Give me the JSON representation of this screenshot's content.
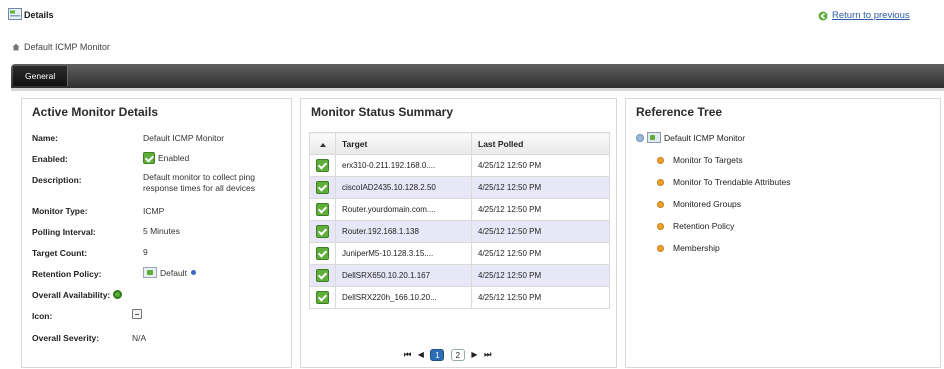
{
  "header": {
    "title": "Details",
    "return_link": "Return to previous"
  },
  "breadcrumb": {
    "text": "Default ICMP Monitor"
  },
  "tabs": [
    {
      "label": "General"
    }
  ],
  "active_monitor_details": {
    "heading": "Active Monitor Details",
    "rows": [
      {
        "label": "Name:",
        "value": "Default ICMP Monitor"
      },
      {
        "label": "Enabled:",
        "value": "Enabled"
      },
      {
        "label": "Description:",
        "value": "Default monitor to collect ping response times for all devices"
      },
      {
        "label": "Monitor Type:",
        "value": "ICMP"
      },
      {
        "label": "Polling Interval:",
        "value": "5 Minutes"
      },
      {
        "label": "Target Count:",
        "value": "9"
      },
      {
        "label": "Retention Policy:",
        "value": "Default"
      },
      {
        "label": "Overall Availability:",
        "value": ""
      },
      {
        "label": "Icon:",
        "value": ""
      },
      {
        "label": "Overall Severity:",
        "value": "N/A"
      }
    ]
  },
  "monitor_status_summary": {
    "heading": "Monitor Status Summary",
    "columns": [
      "",
      "Target",
      "Last Polled"
    ],
    "rows": [
      {
        "target": "erx310-0.211.192.168.0....",
        "last_polled": "4/25/12 12:50 PM"
      },
      {
        "target": "ciscoIAD2435.10.128.2.50",
        "last_polled": "4/25/12 12:50 PM"
      },
      {
        "target": "Router.yourdomain.com....",
        "last_polled": "4/25/12 12:50 PM"
      },
      {
        "target": "Router.192.168.1.138",
        "last_polled": "4/25/12 12:50 PM"
      },
      {
        "target": "JuniperM5-10.128.3.15....",
        "last_polled": "4/25/12 12:50 PM"
      },
      {
        "target": "DellSRX650.10.20.1.167",
        "last_polled": "4/25/12 12:50 PM"
      },
      {
        "target": "DellSRX220h_166.10.20...",
        "last_polled": "4/25/12 12:50 PM"
      }
    ],
    "pager": {
      "first": "⏮",
      "prev": "◀",
      "pages": [
        "1",
        "2"
      ],
      "current": "1",
      "next": "▶",
      "last": "⏭"
    }
  },
  "reference_tree": {
    "heading": "Reference Tree",
    "root": "Default ICMP Monitor",
    "children": [
      "Monitor To Targets",
      "Monitor To Trendable Attributes",
      "Monitored Groups",
      "Retention Policy",
      "Membership"
    ]
  },
  "colors": {
    "tab_bar": "#3f3f3f",
    "row_alt": "#e7e7f7",
    "status_ok": "#5fae3a",
    "link": "#2a5aa8",
    "tree_bullet": "#efa12b"
  }
}
